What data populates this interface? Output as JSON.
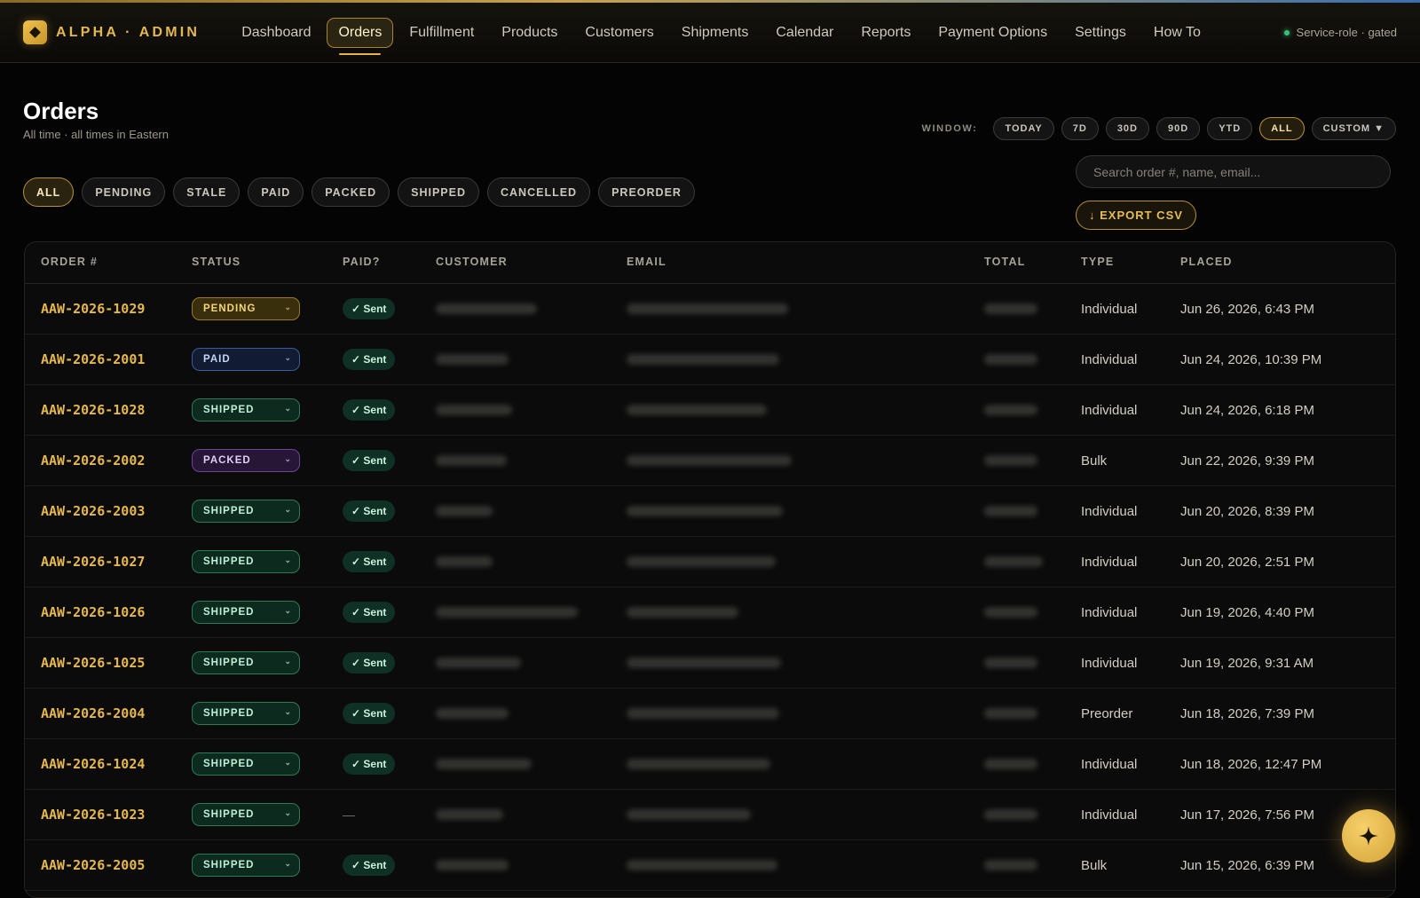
{
  "brand": {
    "name": "ALPHA · ADMIN"
  },
  "nav": {
    "items": [
      "Dashboard",
      "Orders",
      "Fulfillment",
      "Products",
      "Customers",
      "Shipments",
      "Calendar",
      "Reports",
      "Payment Options",
      "Settings",
      "How To"
    ],
    "active": "Orders"
  },
  "service_status": "Service-role · gated",
  "page": {
    "title": "Orders",
    "subtitle": "All time · all times in Eastern"
  },
  "window": {
    "label": "WINDOW:",
    "options": [
      "TODAY",
      "7D",
      "30D",
      "90D",
      "YTD",
      "ALL",
      "CUSTOM ▼"
    ],
    "active": "ALL"
  },
  "filters": {
    "options": [
      "ALL",
      "PENDING",
      "STALE",
      "PAID",
      "PACKED",
      "SHIPPED",
      "CANCELLED",
      "PREORDER"
    ],
    "active": "ALL"
  },
  "search": {
    "placeholder": "Search order #, name, email...",
    "value": ""
  },
  "export_label": "↓ EXPORT CSV",
  "table": {
    "headers": [
      "ORDER #",
      "STATUS",
      "PAID?",
      "CUSTOMER",
      "EMAIL",
      "TOTAL",
      "TYPE",
      "PLACED"
    ],
    "rows": [
      {
        "order": "AAW-2026-1029",
        "status": "PENDING",
        "paid": "✓ Sent",
        "type": "Individual",
        "placed": "Jun 26, 2026, 6:43 PM"
      },
      {
        "order": "AAW-2026-2001",
        "status": "PAID",
        "paid": "✓ Sent",
        "type": "Individual",
        "placed": "Jun 24, 2026, 10:39 PM"
      },
      {
        "order": "AAW-2026-1028",
        "status": "SHIPPED",
        "paid": "✓ Sent",
        "type": "Individual",
        "placed": "Jun 24, 2026, 6:18 PM"
      },
      {
        "order": "AAW-2026-2002",
        "status": "PACKED",
        "paid": "✓ Sent",
        "type": "Bulk",
        "placed": "Jun 22, 2026, 9:39 PM"
      },
      {
        "order": "AAW-2026-2003",
        "status": "SHIPPED",
        "paid": "✓ Sent",
        "type": "Individual",
        "placed": "Jun 20, 2026, 8:39 PM"
      },
      {
        "order": "AAW-2026-1027",
        "status": "SHIPPED",
        "paid": "✓ Sent",
        "type": "Individual",
        "placed": "Jun 20, 2026, 2:51 PM"
      },
      {
        "order": "AAW-2026-1026",
        "status": "SHIPPED",
        "paid": "✓ Sent",
        "type": "Individual",
        "placed": "Jun 19, 2026, 4:40 PM"
      },
      {
        "order": "AAW-2026-1025",
        "status": "SHIPPED",
        "paid": "✓ Sent",
        "type": "Individual",
        "placed": "Jun 19, 2026, 9:31 AM"
      },
      {
        "order": "AAW-2026-2004",
        "status": "SHIPPED",
        "paid": "✓ Sent",
        "type": "Preorder",
        "placed": "Jun 18, 2026, 7:39 PM"
      },
      {
        "order": "AAW-2026-1024",
        "status": "SHIPPED",
        "paid": "✓ Sent",
        "type": "Individual",
        "placed": "Jun 18, 2026, 12:47 PM"
      },
      {
        "order": "AAW-2026-1023",
        "status": "SHIPPED",
        "paid": "—",
        "type": "Individual",
        "placed": "Jun 17, 2026, 7:56 PM"
      },
      {
        "order": "AAW-2026-2005",
        "status": "SHIPPED",
        "paid": "✓ Sent",
        "type": "Bulk",
        "placed": "Jun 15, 2026, 6:39 PM"
      }
    ]
  },
  "colors": {
    "accent": "#e6b84b",
    "background": "#040404",
    "shipped": "#2c7a57",
    "paid": "#3a5b99",
    "packed": "#6c4498",
    "pending": "#9a7a25"
  },
  "icons": {
    "logo": "diamond-logo-icon",
    "fab": "sparkle-icon",
    "status_dot": "status-dot-icon",
    "status_chevron": "chevron-down-icon"
  }
}
